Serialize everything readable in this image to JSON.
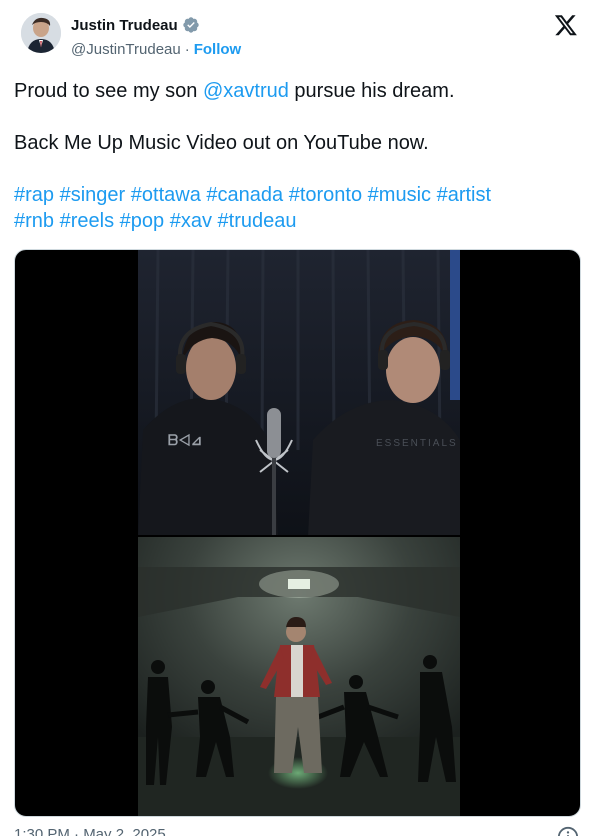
{
  "author": {
    "display_name": "Justin Trudeau",
    "handle": "@JustinTrudeau",
    "separator": "·",
    "follow_label": "Follow",
    "verified": true
  },
  "tweet": {
    "line1_pre": "Proud to see my son ",
    "line1_mention": "@xavtrud",
    "line1_post": " pursue his dream.",
    "line2": "Back Me Up Music Video out on YouTube now.",
    "hashtags": [
      "#rap",
      "#singer",
      "#ottawa",
      "#canada",
      "#toronto",
      "#music",
      "#artist",
      "#rnb",
      "#reels",
      "#pop",
      "#xav",
      "#trudeau"
    ]
  },
  "footer": {
    "timestamp": "1:30 PM · May 2, 2025"
  },
  "colors": {
    "accent": "#1d9bf0",
    "text": "#0f1419",
    "secondary": "#536471",
    "verified_badge": "#829aab"
  },
  "icons": {
    "verified": "verified-badge-icon",
    "logo": "x-logo-icon",
    "info": "info-icon"
  }
}
